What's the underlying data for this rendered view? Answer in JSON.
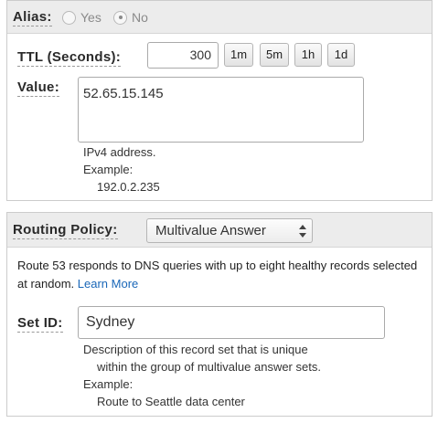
{
  "alias": {
    "label": "Alias:",
    "yes": "Yes",
    "no": "No",
    "selected": "No"
  },
  "ttl": {
    "label": "TTL (Seconds):",
    "value": "300",
    "buttons": [
      "1m",
      "5m",
      "1h",
      "1d"
    ]
  },
  "value_field": {
    "label": "Value:",
    "text": "52.65.15.145",
    "help": [
      "IPv4 address.",
      "Example:",
      "192.0.2.235"
    ]
  },
  "routing": {
    "label": "Routing Policy:",
    "selected": "Multivalue Answer",
    "description": "Route 53 responds to DNS queries with up to eight healthy records selected at random.",
    "learn_more": "Learn More"
  },
  "set_id": {
    "label": "Set ID:",
    "value": "Sydney",
    "help": [
      "Description of this record set that is unique",
      "within the group of multivalue answer sets.",
      "Example:",
      "Route to Seattle data center"
    ]
  }
}
